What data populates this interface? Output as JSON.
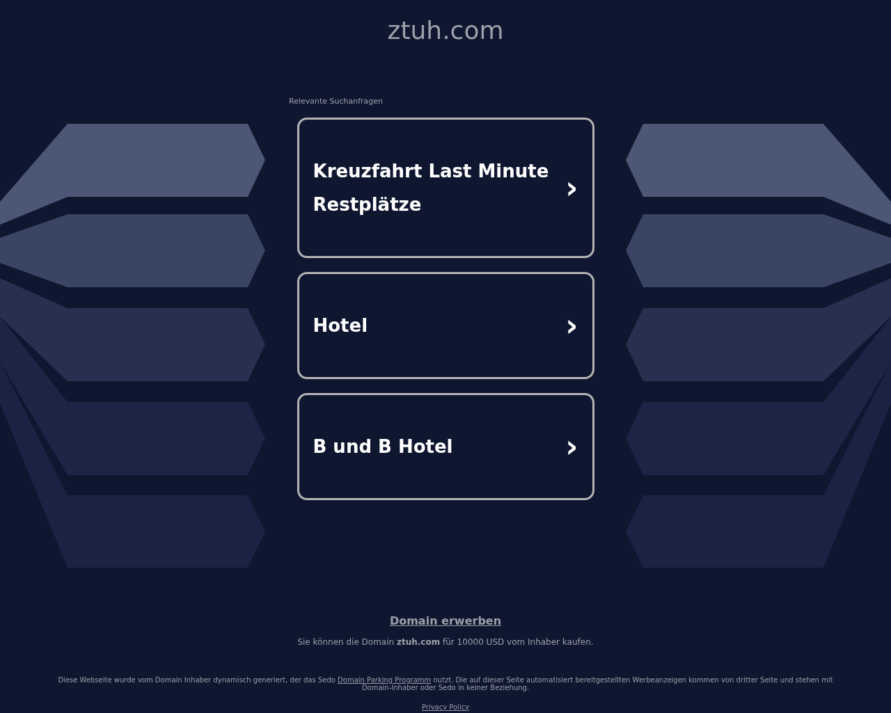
{
  "site_title": "ztuh.com",
  "related_label": "Relevante Suchanfragen",
  "links": [
    {
      "label": "Kreuzfahrt Last Minute Restplätze",
      "icon": "›"
    },
    {
      "label": "Hotel",
      "icon": "›"
    },
    {
      "label": "B und B Hotel",
      "icon": "›"
    }
  ],
  "buy": {
    "link": "Domain erwerben",
    "text": "Sie können die Domain **ztuh.com** für 10000 USD vom Inhaber kaufen."
  },
  "disclaimer": {
    "before": "Diese Webseite wurde vom Domain Inhaber dynamisch generiert, der das Sedo",
    "link": "Domain Parking Programm",
    "after": "nutzt. Die auf dieser Seite automatisiert bereitgestellten Werbeanzeigen kommen von dritter Seite und stehen mit Domain-Inhaber oder Sedo in keiner Beziehung."
  },
  "privacy_link": "Privacy Policy"
}
